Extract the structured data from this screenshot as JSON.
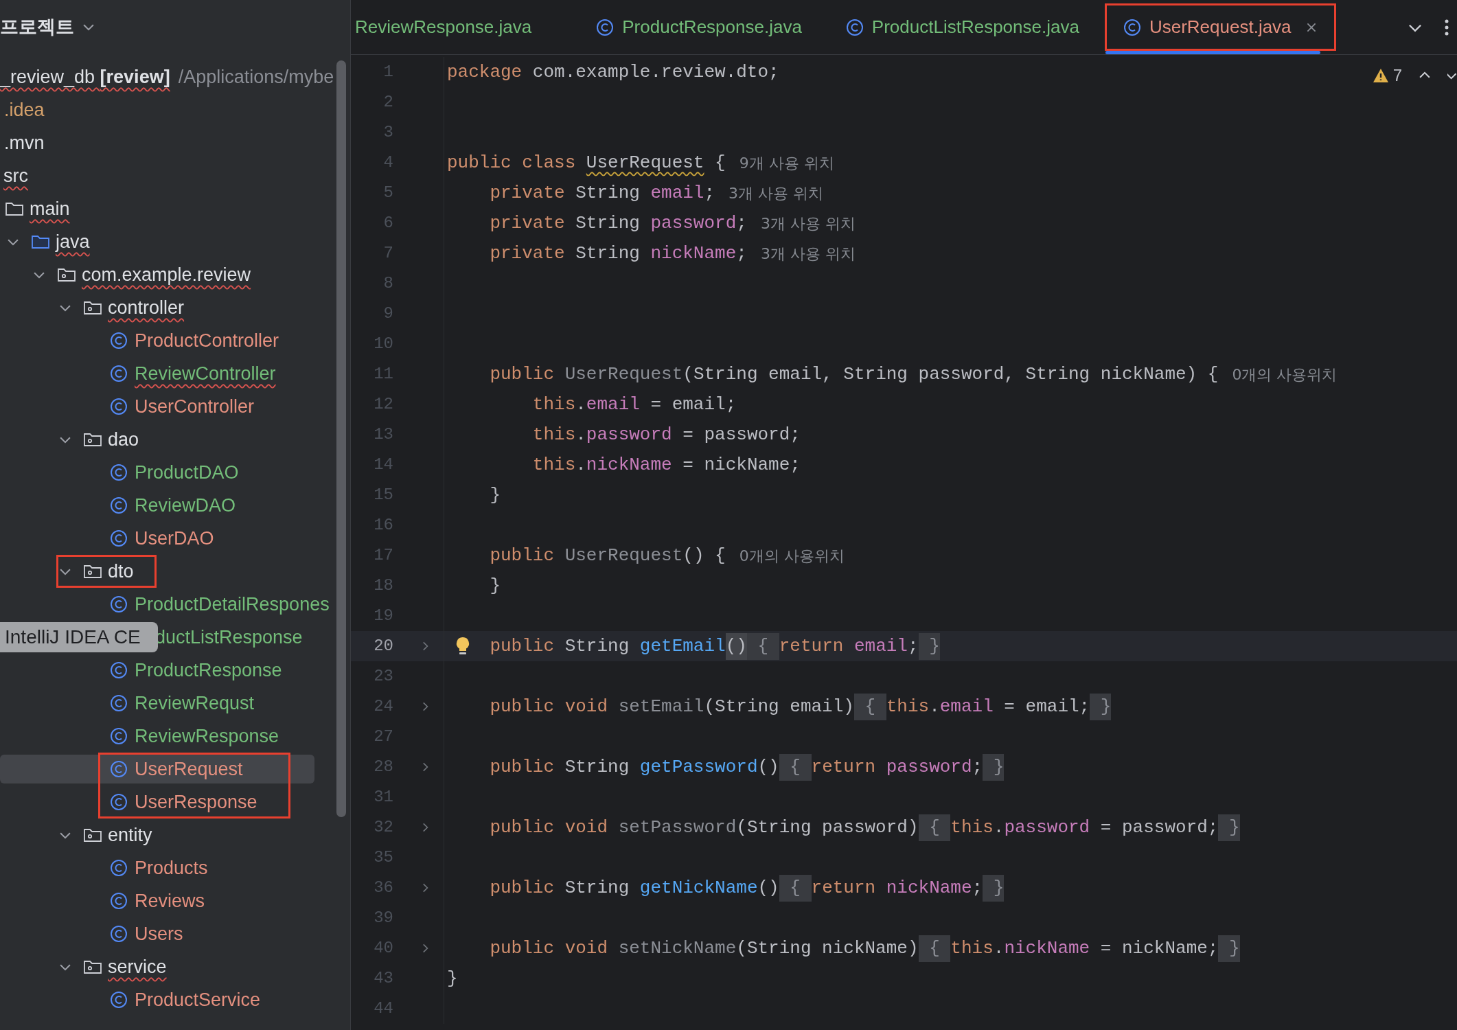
{
  "project_header": {
    "title": "프로젝트"
  },
  "tree": [
    {
      "name": "_review_db **[review]**",
      "path": "/Applications/mybe",
      "error": true,
      "children": [
        {
          "name": ".idea",
          "color": "#d5a16b"
        },
        {
          "name": ".mvn"
        },
        {
          "name": "src",
          "error": true,
          "children": [
            {
              "name": "main",
              "kind": "folder",
              "error": true,
              "children": [
                {
                  "name": "java",
                  "kind": "source",
                  "error": true,
                  "expanded": true,
                  "children": [
                    {
                      "name": "com.example.review",
                      "kind": "package",
                      "error": true,
                      "expanded": true,
                      "children": [
                        {
                          "name": "controller",
                          "kind": "package",
                          "error": true,
                          "expanded": true,
                          "children": [
                            {
                              "name": "ProductController",
                              "kind": "class",
                              "color": "#e5907f",
                              "selected": false
                            },
                            {
                              "name": "ReviewController",
                              "kind": "class",
                              "color": "#73bd79",
                              "error": true,
                              "selected": false
                            },
                            {
                              "name": "UserController",
                              "kind": "class",
                              "color": "#e5907f",
                              "selected": false
                            }
                          ]
                        },
                        {
                          "name": "dao",
                          "kind": "package",
                          "expanded": true,
                          "children": [
                            {
                              "name": "ProductDAO",
                              "kind": "class",
                              "color": "#73bd79",
                              "selected": false
                            },
                            {
                              "name": "ReviewDAO",
                              "kind": "class",
                              "color": "#73bd79",
                              "selected": false
                            },
                            {
                              "name": "UserDAO",
                              "kind": "class",
                              "color": "#e5907f",
                              "selected": false
                            }
                          ]
                        },
                        {
                          "name": "dto",
                          "kind": "package",
                          "expanded": true,
                          "annotated": true,
                          "children": [
                            {
                              "name": "ProductDetailRespones",
                              "kind": "class",
                              "color": "#73bd79",
                              "selected": false
                            },
                            {
                              "name": "ductListResponse",
                              "kind": "class",
                              "color": "#73bd79",
                              "tooltip": "IntelliJ IDEA CE",
                              "selected": false
                            },
                            {
                              "name": "ProductResponse",
                              "kind": "class",
                              "color": "#73bd79",
                              "selected": false
                            },
                            {
                              "name": "ReviewRequst",
                              "kind": "class",
                              "color": "#73bd79",
                              "selected": false
                            },
                            {
                              "name": "ReviewResponse",
                              "kind": "class",
                              "color": "#73bd79",
                              "selected": false
                            },
                            {
                              "name": "UserRequest",
                              "kind": "class",
                              "color": "#e5907f",
                              "annotated": true,
                              "selected": true
                            },
                            {
                              "name": "UserResponse",
                              "kind": "class",
                              "color": "#e5907f",
                              "annotated": true,
                              "selected": false
                            }
                          ]
                        },
                        {
                          "name": "entity",
                          "kind": "package",
                          "expanded": true,
                          "children": [
                            {
                              "name": "Products",
                              "kind": "class",
                              "color": "#e5907f",
                              "selected": false
                            },
                            {
                              "name": "Reviews",
                              "kind": "class",
                              "color": "#e5907f",
                              "selected": false
                            },
                            {
                              "name": "Users",
                              "kind": "class",
                              "color": "#e5907f",
                              "selected": false
                            }
                          ]
                        },
                        {
                          "name": "service",
                          "kind": "package",
                          "error": true,
                          "expanded": true,
                          "children": [
                            {
                              "name": "ProductService",
                              "kind": "class",
                              "color": "#e5907f",
                              "selected": false
                            }
                          ]
                        }
                      ]
                    }
                  ]
                }
              ]
            }
          ]
        }
      ]
    }
  ],
  "tabs": [
    {
      "label": "ReviewResponse.java",
      "color": "#73bd79",
      "icon": false,
      "selected": false,
      "annotated": false
    },
    {
      "label": "ProductResponse.java",
      "color": "#73bd79",
      "icon": true,
      "selected": false,
      "annotated": false
    },
    {
      "label": "ProductListResponse.java",
      "color": "#73bd79",
      "icon": true,
      "selected": false,
      "annotated": false
    },
    {
      "label": "UserRequest.java",
      "color": "#e5907f",
      "icon": true,
      "selected": true,
      "annotated": true
    }
  ],
  "warnings": {
    "count": "7"
  },
  "lines": [
    {
      "number": "1",
      "tokens": [
        {
          "text": "package",
          "kind": "kw"
        },
        {
          "text": " com.example.review.dto;",
          "kind": "plain"
        }
      ]
    },
    {
      "number": "2"
    },
    {
      "number": "3"
    },
    {
      "number": "4",
      "tokens": [
        {
          "text": "public class ",
          "kind": "kw"
        },
        {
          "text": "UserRequest",
          "kind": "warn"
        },
        {
          "text": " {",
          "kind": "plain"
        },
        {
          "text": "9개 사용 위치",
          "kind": "hint"
        }
      ]
    },
    {
      "number": "5",
      "tokens": [
        {
          "text": "    private ",
          "kind": "kw"
        },
        {
          "text": "String ",
          "kind": "plain"
        },
        {
          "text": "email",
          "kind": "field"
        },
        {
          "text": ";",
          "kind": "plain"
        },
        {
          "text": "3개 사용 위치",
          "kind": "hint"
        }
      ]
    },
    {
      "number": "6",
      "tokens": [
        {
          "text": "    private ",
          "kind": "kw"
        },
        {
          "text": "String ",
          "kind": "plain"
        },
        {
          "text": "password",
          "kind": "field"
        },
        {
          "text": ";",
          "kind": "plain"
        },
        {
          "text": "3개 사용 위치",
          "kind": "hint"
        }
      ]
    },
    {
      "number": "7",
      "tokens": [
        {
          "text": "    private ",
          "kind": "kw"
        },
        {
          "text": "String ",
          "kind": "plain"
        },
        {
          "text": "nickName",
          "kind": "field"
        },
        {
          "text": ";",
          "kind": "plain"
        },
        {
          "text": "3개 사용 위치",
          "kind": "hint"
        }
      ]
    },
    {
      "number": "8"
    },
    {
      "number": "9"
    },
    {
      "number": "10"
    },
    {
      "number": "11",
      "tokens": [
        {
          "text": "    public ",
          "kind": "kw"
        },
        {
          "text": "UserRequest",
          "kind": "unused"
        },
        {
          "text": "(String email, String password, String nickName) {",
          "kind": "plain"
        },
        {
          "text": "0개의 사용위치",
          "kind": "hint"
        }
      ]
    },
    {
      "number": "12",
      "tokens": [
        {
          "text": "        this",
          "kind": "kw"
        },
        {
          "text": ".",
          "kind": "plain"
        },
        {
          "text": "email",
          "kind": "field"
        },
        {
          "text": " = email;",
          "kind": "plain"
        }
      ]
    },
    {
      "number": "13",
      "tokens": [
        {
          "text": "        this",
          "kind": "kw"
        },
        {
          "text": ".",
          "kind": "plain"
        },
        {
          "text": "password",
          "kind": "field"
        },
        {
          "text": " = password;",
          "kind": "plain"
        }
      ]
    },
    {
      "number": "14",
      "tokens": [
        {
          "text": "        this",
          "kind": "kw"
        },
        {
          "text": ".",
          "kind": "plain"
        },
        {
          "text": "nickName",
          "kind": "field"
        },
        {
          "text": " = nickName;",
          "kind": "plain"
        }
      ]
    },
    {
      "number": "15",
      "tokens": [
        {
          "text": "    }",
          "kind": "plain"
        }
      ]
    },
    {
      "number": "16"
    },
    {
      "number": "17",
      "tokens": [
        {
          "text": "    public ",
          "kind": "kw"
        },
        {
          "text": "UserRequest",
          "kind": "unused"
        },
        {
          "text": "() {",
          "kind": "plain"
        },
        {
          "text": "0개의 사용위치",
          "kind": "hint"
        }
      ]
    },
    {
      "number": "18",
      "tokens": [
        {
          "text": "    }",
          "kind": "plain"
        }
      ]
    },
    {
      "number": "19"
    },
    {
      "number": "20",
      "current": true,
      "intention": true,
      "folded": true,
      "tokens": [
        {
          "text": "    public ",
          "kind": "kw"
        },
        {
          "text": "String ",
          "kind": "plain"
        },
        {
          "text": "getEmail",
          "kind": "method"
        },
        {
          "text": "()",
          "kind": "match"
        },
        {
          "text": " { ",
          "kind": "fold"
        },
        {
          "text": "return ",
          "kind": "kw"
        },
        {
          "text": "email",
          "kind": "field"
        },
        {
          "text": ";",
          "kind": "plain"
        },
        {
          "text": " }",
          "kind": "fold"
        }
      ]
    },
    {
      "number": "23"
    },
    {
      "number": "24",
      "folded": true,
      "tokens": [
        {
          "text": "    public void ",
          "kind": "kw"
        },
        {
          "text": "setEmail",
          "kind": "unused"
        },
        {
          "text": "(String email)",
          "kind": "plain"
        },
        {
          "text": " { ",
          "kind": "fold"
        },
        {
          "text": "this",
          "kind": "kw"
        },
        {
          "text": ".",
          "kind": "plain"
        },
        {
          "text": "email",
          "kind": "field"
        },
        {
          "text": " = email;",
          "kind": "plain"
        },
        {
          "text": " }",
          "kind": "fold"
        }
      ]
    },
    {
      "number": "27"
    },
    {
      "number": "28",
      "folded": true,
      "tokens": [
        {
          "text": "    public ",
          "kind": "kw"
        },
        {
          "text": "String ",
          "kind": "plain"
        },
        {
          "text": "getPassword",
          "kind": "method"
        },
        {
          "text": "()",
          "kind": "plain"
        },
        {
          "text": " { ",
          "kind": "fold"
        },
        {
          "text": "return ",
          "kind": "kw"
        },
        {
          "text": "password",
          "kind": "field"
        },
        {
          "text": ";",
          "kind": "plain"
        },
        {
          "text": " }",
          "kind": "fold"
        }
      ]
    },
    {
      "number": "31"
    },
    {
      "number": "32",
      "folded": true,
      "tokens": [
        {
          "text": "    public void ",
          "kind": "kw"
        },
        {
          "text": "setPassword",
          "kind": "unused"
        },
        {
          "text": "(String password)",
          "kind": "plain"
        },
        {
          "text": " { ",
          "kind": "fold"
        },
        {
          "text": "this",
          "kind": "kw"
        },
        {
          "text": ".",
          "kind": "plain"
        },
        {
          "text": "password",
          "kind": "field"
        },
        {
          "text": " = password;",
          "kind": "plain"
        },
        {
          "text": " }",
          "kind": "fold"
        }
      ]
    },
    {
      "number": "35"
    },
    {
      "number": "36",
      "folded": true,
      "tokens": [
        {
          "text": "    public ",
          "kind": "kw"
        },
        {
          "text": "String ",
          "kind": "plain"
        },
        {
          "text": "getNickName",
          "kind": "method"
        },
        {
          "text": "()",
          "kind": "plain"
        },
        {
          "text": " { ",
          "kind": "fold"
        },
        {
          "text": "return ",
          "kind": "kw"
        },
        {
          "text": "nickName",
          "kind": "field"
        },
        {
          "text": ";",
          "kind": "plain"
        },
        {
          "text": " }",
          "kind": "fold"
        }
      ]
    },
    {
      "number": "39"
    },
    {
      "number": "40",
      "folded": true,
      "tokens": [
        {
          "text": "    public void ",
          "kind": "kw"
        },
        {
          "text": "setNickName",
          "kind": "unused"
        },
        {
          "text": "(String nickName)",
          "kind": "plain"
        },
        {
          "text": " { ",
          "kind": "fold"
        },
        {
          "text": "this",
          "kind": "kw"
        },
        {
          "text": ".",
          "kind": "plain"
        },
        {
          "text": "nickName",
          "kind": "field"
        },
        {
          "text": " = nickName;",
          "kind": "plain"
        },
        {
          "text": " }",
          "kind": "fold"
        }
      ]
    },
    {
      "number": "43",
      "tokens": [
        {
          "text": "}",
          "kind": "plain"
        }
      ]
    },
    {
      "number": "44"
    }
  ]
}
